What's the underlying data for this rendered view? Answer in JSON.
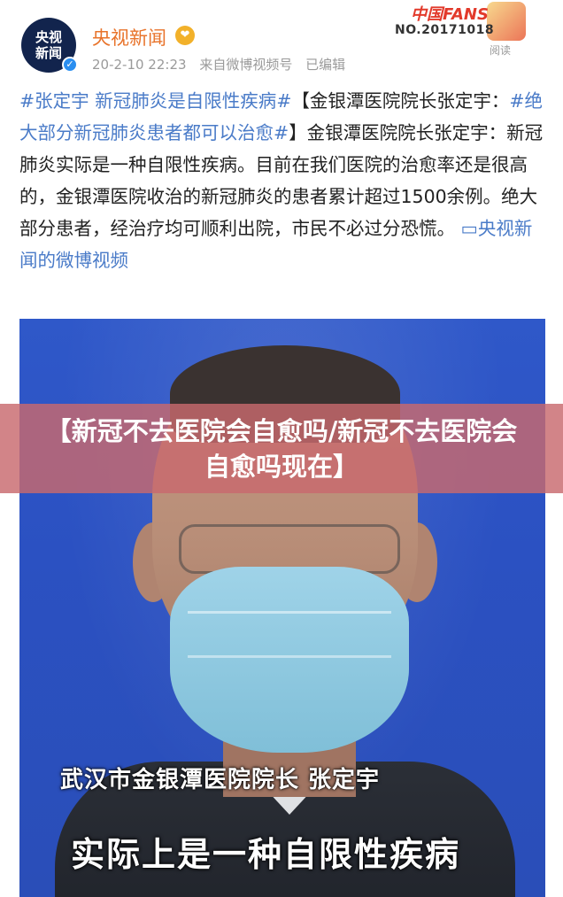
{
  "header": {
    "avatar_line1": "央视",
    "avatar_line2": "新闻",
    "verified_icon": "✓",
    "account_name": "央视新闻",
    "badge_icon": "❤",
    "timestamp": "20-2-10 22:23",
    "source": "来自微博视频号",
    "edited": "已编辑",
    "fans_label": "中国FANS",
    "fans_number": "NO.20171018",
    "read_label": "阅读"
  },
  "post": {
    "tag1": "#张定宇 新冠肺炎是自限性疾病#",
    "text1": "【金银潭医院院长张定宇：",
    "tag2": "#绝大部分新冠肺炎患者都可以治愈#",
    "text2": "】金银潭医院院长张定宇：新冠肺炎实际是一种自限性疾病。目前在我们医院的治愈率还是很高的，金银潭医院收治的新冠肺炎的患者累计超过1500余例。绝大部分患者，经治疗均可顺利出院，市民不必过分恐慌。",
    "link_icon": "▭",
    "link": "央视新闻的微博视频"
  },
  "video": {
    "caption_name": "武汉市金银潭医院院长 张定宇",
    "caption_quote": "实际上是一种自限性疾病"
  },
  "banner": {
    "title": "【新冠不去医院会自愈吗/新冠不去医院会自愈吗现在】"
  }
}
